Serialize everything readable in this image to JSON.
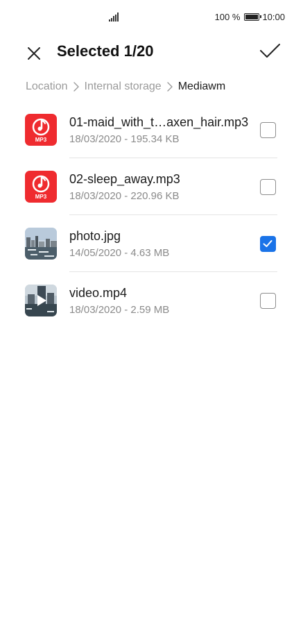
{
  "status_bar": {
    "battery_percent": "100 %",
    "time": "10:00",
    "icons": [
      "signal-icon",
      "battery-icon"
    ]
  },
  "header": {
    "title": "Selected 1/20",
    "close_icon": "close-icon",
    "confirm_icon": "check-icon"
  },
  "breadcrumb": [
    {
      "label": "Location",
      "current": false
    },
    {
      "label": "Internal storage",
      "current": false
    },
    {
      "label": "Mediawm",
      "current": true
    }
  ],
  "files": [
    {
      "name": "01-maid_with_t…axen_hair.mp3",
      "meta": "18/03/2020 - 195.34 KB",
      "type": "mp3",
      "thumb_label": "MP3",
      "checked": false
    },
    {
      "name": "02-sleep_away.mp3",
      "meta": "18/03/2020 - 220.96 KB",
      "type": "mp3",
      "thumb_label": "MP3",
      "checked": false
    },
    {
      "name": "photo.jpg",
      "meta": "14/05/2020 - 4.63 MB",
      "type": "image",
      "checked": true
    },
    {
      "name": "video.mp4",
      "meta": "18/03/2020 - 2.59 MB",
      "type": "video",
      "checked": false
    }
  ],
  "colors": {
    "accent": "#1a73e8",
    "mp3_red": "#ef2b2f",
    "secondary_text": "#8a8a8a"
  }
}
